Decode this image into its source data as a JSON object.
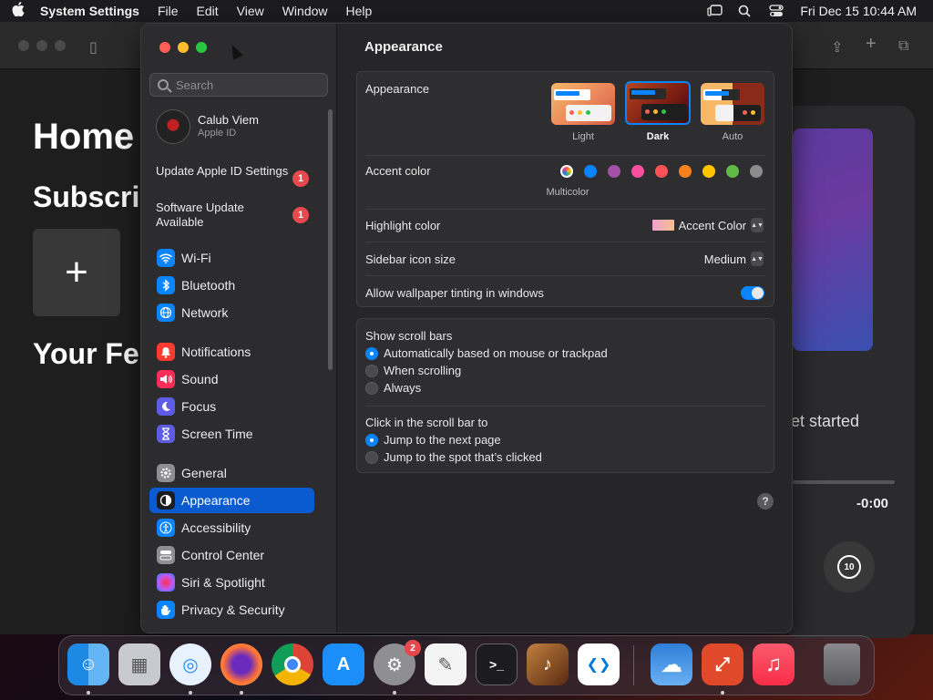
{
  "menubar": {
    "app_name": "System Settings",
    "items": [
      "File",
      "Edit",
      "View",
      "Window",
      "Help"
    ],
    "datetime": "Fri Dec 15  10:44 AM"
  },
  "background_app": {
    "heading_home": "Home",
    "heading_subscriptions": "Subscri",
    "heading_feed": "Your Fe",
    "get_started_text": "et started",
    "time_remaining": "-0:00",
    "skip_label": "10"
  },
  "window": {
    "search_placeholder": "Search",
    "user": {
      "name": "Calub Viem",
      "subtitle": "Apple ID"
    },
    "updates": [
      {
        "label": "Update Apple ID Settings",
        "count": "1"
      },
      {
        "label": "Software Update Available",
        "count": "1"
      }
    ],
    "nav_groups": [
      [
        {
          "label": "Wi-Fi",
          "icon": "wifi-icon",
          "color": "#0a84ff"
        },
        {
          "label": "Bluetooth",
          "icon": "bluetooth-icon",
          "color": "#0a84ff"
        },
        {
          "label": "Network",
          "icon": "globe-icon",
          "color": "#0a84ff"
        }
      ],
      [
        {
          "label": "Notifications",
          "icon": "bell-icon",
          "color": "#ff3b30"
        },
        {
          "label": "Sound",
          "icon": "speaker-icon",
          "color": "#ff2d55"
        },
        {
          "label": "Focus",
          "icon": "moon-icon",
          "color": "#5e5ce6"
        },
        {
          "label": "Screen Time",
          "icon": "hourglass-icon",
          "color": "#5e5ce6"
        }
      ],
      [
        {
          "label": "General",
          "icon": "gear-icon",
          "color": "#8e8e93"
        },
        {
          "label": "Appearance",
          "icon": "appearance-icon",
          "color": "#1c1c1e",
          "selected": true
        },
        {
          "label": "Accessibility",
          "icon": "accessibility-icon",
          "color": "#0a84ff"
        },
        {
          "label": "Control Center",
          "icon": "control-center-icon",
          "color": "#8e8e93"
        },
        {
          "label": "Siri & Spotlight",
          "icon": "siri-icon",
          "color": "#bf5af2"
        },
        {
          "label": "Privacy & Security",
          "icon": "hand-icon",
          "color": "#0a84ff"
        }
      ]
    ]
  },
  "appearance": {
    "title": "Appearance",
    "appearance_label": "Appearance",
    "modes": [
      {
        "label": "Light",
        "selected": false
      },
      {
        "label": "Dark",
        "selected": true
      },
      {
        "label": "Auto",
        "selected": false
      }
    ],
    "accent_label": "Accent color",
    "accent_caption": "Multicolor",
    "accent_colors": [
      "multicolor",
      "#0a84ff",
      "#a550a7",
      "#f74f9e",
      "#ff5257",
      "#f7821b",
      "#ffc600",
      "#62ba46",
      "#8c8c8c"
    ],
    "highlight_label": "Highlight color",
    "highlight_value": "Accent Color",
    "sidebar_icon_label": "Sidebar icon size",
    "sidebar_icon_value": "Medium",
    "tinting_label": "Allow wallpaper tinting in windows",
    "tinting_enabled": true,
    "scrollbars_label": "Show scroll bars",
    "scrollbar_options": [
      {
        "label": "Automatically based on mouse or trackpad",
        "selected": true
      },
      {
        "label": "When scrolling",
        "selected": false
      },
      {
        "label": "Always",
        "selected": false
      }
    ],
    "click_label": "Click in the scroll bar to",
    "click_options": [
      {
        "label": "Jump to the next page",
        "selected": true
      },
      {
        "label": "Jump to the spot that’s clicked",
        "selected": false
      }
    ],
    "help_label": "?"
  },
  "dock": {
    "apps": [
      {
        "name": "finder-icon",
        "color": "#1e88e5",
        "glyph": "☺",
        "running": true
      },
      {
        "name": "launchpad-icon",
        "color": "#c9c9d2",
        "glyph": "▦",
        "running": false
      },
      {
        "name": "safari-icon",
        "color": "#1a8cff",
        "glyph": "◎",
        "running": true
      },
      {
        "name": "firefox-icon",
        "color": "#ff7139",
        "glyph": "●",
        "running": true
      },
      {
        "name": "chrome-icon",
        "color": "#e8e8e8",
        "glyph": "◉",
        "running": false
      },
      {
        "name": "app-store-icon",
        "color": "#1c8ef9",
        "glyph": "A",
        "running": false
      },
      {
        "name": "system-settings-icon",
        "color": "#8e8e93",
        "glyph": "⚙",
        "running": true,
        "badge": "2"
      },
      {
        "name": "textedit-icon",
        "color": "#f4f4f4",
        "glyph": "✎",
        "running": false
      },
      {
        "name": "terminal-icon",
        "color": "#1c1c1e",
        "glyph": ">_",
        "running": false
      },
      {
        "name": "garageband-icon",
        "color": "#8a5a2a",
        "glyph": "♪",
        "running": false
      },
      {
        "name": "vscode-icon",
        "color": "#ffffff",
        "glyph": "❮❯",
        "running": false
      },
      {
        "name": "weather-icon",
        "color": "#2f7fd9",
        "glyph": "☁",
        "running": false
      },
      {
        "name": "remote-desktop-icon",
        "color": "#e04a2a",
        "glyph": "⤢",
        "running": true
      },
      {
        "name": "music-icon",
        "color": "#fa3c4c",
        "glyph": "♫",
        "running": false
      },
      {
        "name": "trash-icon",
        "color": "#6a6a6e",
        "glyph": "🗑",
        "running": false
      }
    ]
  }
}
